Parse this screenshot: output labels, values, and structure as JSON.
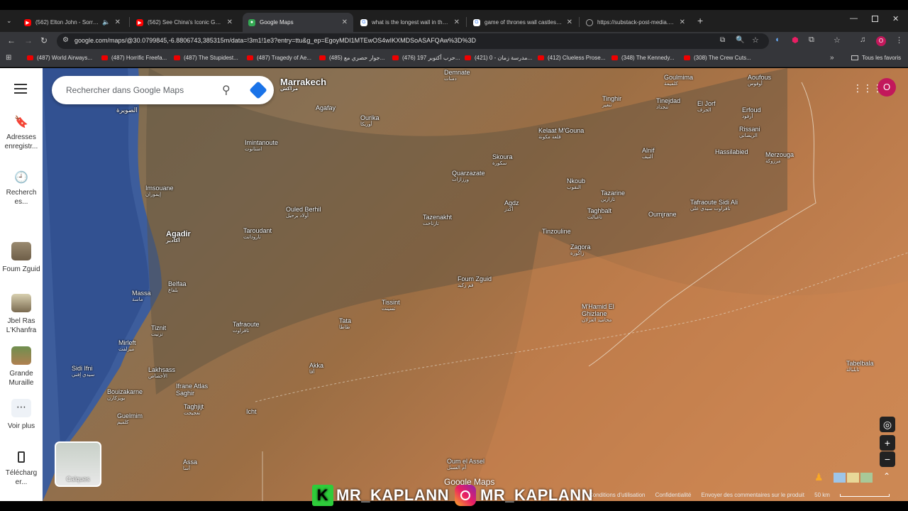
{
  "tabs": [
    {
      "title": "(562) Elton John - Sorry Seems",
      "favicon": "youtube-icon",
      "active": false
    },
    {
      "title": "(562) See China's Iconic Great W",
      "favicon": "youtube-icon",
      "active": false
    },
    {
      "title": "Google Maps",
      "favicon": "google-maps-icon",
      "active": true
    },
    {
      "title": "what is the longest wall in the w",
      "favicon": "google-icon",
      "active": false
    },
    {
      "title": "game of thrones wall castles m",
      "favicon": "google-icon",
      "active": false
    },
    {
      "title": "https://substack-post-media.s3.",
      "favicon": "globe-icon",
      "active": false
    }
  ],
  "address": {
    "url": "google.com/maps/@30.0799845,-6.8806743,385315m/data=!3m1!1e3?entry=ttu&g_ep=EgoyMDI1MTEwOS4wIKXMDSoASAFQAw%3D%3D"
  },
  "bookmarks": [
    "(487) World Airways...",
    "(487) Horrific Freefa...",
    "(487) The Stupidest...",
    "(487) Tragedy of Ae...",
    "(485) جوار حصري مع...",
    "(476) حرب أكتوبر 197...",
    "(421) مدرسة زمان - 0...",
    "(412) Clueless Prose...",
    "(348) The Kennedy...",
    "(308) The Crew Cuts..."
  ],
  "bookmarks_all": "Tous les favoris",
  "search": {
    "placeholder": "Rechercher dans Google Maps"
  },
  "sidebar": {
    "saved": "Adresses enregistr...",
    "recent": "Recherch es...",
    "places": [
      "Foum Zguid",
      "Jbel Ras L'Khanfra",
      "Grande Muraille"
    ],
    "more": "Voir plus",
    "download": "Télécharg er..."
  },
  "map_places": [
    {
      "name": "Marrakech",
      "ar": "مراكش",
      "big": true
    },
    {
      "name": "Agafay",
      "ar": ""
    },
    {
      "name": "Ourika",
      "ar": "أوريكا"
    },
    {
      "name": "Imintanoute",
      "ar": "امنتانوت"
    },
    {
      "name": "Demnate",
      "ar": "دمنات"
    },
    {
      "name": "Kelaat M'Gouna",
      "ar": "قلعة مكونة"
    },
    {
      "name": "Skoura",
      "ar": "سكورة"
    },
    {
      "name": "Quarzazate",
      "ar": "ورزازات"
    },
    {
      "name": "Tinghir",
      "ar": "تنغير"
    },
    {
      "name": "Goulmima",
      "ar": "كلميمة"
    },
    {
      "name": "Tinejdad",
      "ar": "تنجداد"
    },
    {
      "name": "El Jorf",
      "ar": "الجرف"
    },
    {
      "name": "Aoufous",
      "ar": "أوفوس"
    },
    {
      "name": "Erfoud",
      "ar": "أرفود"
    },
    {
      "name": "Rissani",
      "ar": "الريصاني"
    },
    {
      "name": "Hassilabied",
      "ar": ""
    },
    {
      "name": "Merzouga",
      "ar": "مرزوكة"
    },
    {
      "name": "Alnif",
      "ar": "ألنيف"
    },
    {
      "name": "Nkoub",
      "ar": "النقوب"
    },
    {
      "name": "Tazarine",
      "ar": "تازارين"
    },
    {
      "name": "Taghbalt",
      "ar": "تاغبالت"
    },
    {
      "name": "Oumjrane",
      "ar": ""
    },
    {
      "name": "Tafraoute Sidi Ali",
      "ar": "تافراوت سيدي علي"
    },
    {
      "name": "Agdz",
      "ar": "أكدز"
    },
    {
      "name": "Tazenakht",
      "ar": "تازناخت"
    },
    {
      "name": "Tinzouline",
      "ar": ""
    },
    {
      "name": "Zagora",
      "ar": "زاكورة"
    },
    {
      "name": "Imsouane",
      "ar": "إيموران"
    },
    {
      "name": "Ouled Berhil",
      "ar": "أولاد برحيل"
    },
    {
      "name": "Taroudant",
      "ar": "تارودانت"
    },
    {
      "name": "Agadir",
      "ar": "أكادير"
    },
    {
      "name": "Belfaa",
      "ar": "بلفاع"
    },
    {
      "name": "Massa",
      "ar": "ماسة"
    },
    {
      "name": "Foum Zguid",
      "ar": "فم زكيد"
    },
    {
      "name": "Tissint",
      "ar": "تسينت"
    },
    {
      "name": "Tata",
      "ar": "طاطا"
    },
    {
      "name": "M'Hamid El Ghizlane",
      "ar": "محاميد الغزلان"
    },
    {
      "name": "Tiznit",
      "ar": "تزنيت"
    },
    {
      "name": "Tafraoute",
      "ar": "تافراوت"
    },
    {
      "name": "Mirleft",
      "ar": "ميرلفت"
    },
    {
      "name": "Akka",
      "ar": "أقا"
    },
    {
      "name": "Sidi Ifni",
      "ar": "سيدي إفني"
    },
    {
      "name": "Lakhsass",
      "ar": "الأخصاص"
    },
    {
      "name": "Ifrane Atlas Saghir",
      "ar": ""
    },
    {
      "name": "Taghjijt",
      "ar": "تغجيجت"
    },
    {
      "name": "Bouizakarne",
      "ar": "بويزكارن"
    },
    {
      "name": "Guelmim",
      "ar": "كلميم"
    },
    {
      "name": "Icht",
      "ar": ""
    },
    {
      "name": "Assa",
      "ar": "آسا"
    },
    {
      "name": "Oum el Assel",
      "ar": "أم العسل"
    },
    {
      "name": "Tabelbala",
      "ar": "تابلبالة"
    },
    {
      "name": "Essaouira",
      "ar": "الصويرة"
    }
  ],
  "layers_label": "Calques",
  "google_maps_logo": "Google Maps",
  "footer_links": [
    "Conditions d'utilisation",
    "Confidentialité",
    "Envoyer des commentaires sur le produit"
  ],
  "scale": "50 km",
  "watermark": {
    "text1": "MR_KAPLANN",
    "text2": "MR_KAPLANN",
    "k": "K"
  },
  "avatar_letter": "O",
  "colors": {
    "accent": "#1a73e8",
    "avatar": "#c2185b",
    "youtube": "#ff0000"
  }
}
